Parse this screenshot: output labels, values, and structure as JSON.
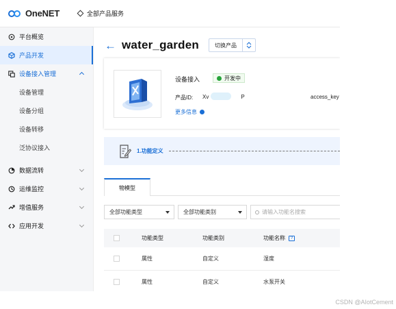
{
  "topbar": {
    "logo_text": "OneNET",
    "all_products": "全部产品服务"
  },
  "sidebar": {
    "items": [
      {
        "label": "平台概览",
        "icon": "circle-gear-icon",
        "state": "normal"
      },
      {
        "label": "产品开发",
        "icon": "cube-icon",
        "state": "active"
      },
      {
        "label": "设备接入管理",
        "icon": "device-icon",
        "state": "open"
      },
      {
        "label": "设备管理",
        "sub": true
      },
      {
        "label": "设备分组",
        "sub": true
      },
      {
        "label": "设备转移",
        "sub": true
      },
      {
        "label": "泛协议接入",
        "sub": true
      },
      {
        "label": "数据流转",
        "icon": "flow-icon",
        "state": "collapsed"
      },
      {
        "label": "运维监控",
        "icon": "monitor-icon",
        "state": "collapsed"
      },
      {
        "label": "增值服务",
        "icon": "plus-service-icon",
        "state": "collapsed"
      },
      {
        "label": "应用开发",
        "icon": "app-dev-icon",
        "state": "collapsed"
      }
    ]
  },
  "product": {
    "name": "water_garden",
    "switch_label": "切换产品",
    "card_title": "设备接入",
    "status": "开发中",
    "pid_label": "产品ID:",
    "pid_prefix": "Xv",
    "pid_suffix": "P",
    "access_key_label": "access_key",
    "more_info": "更多信息"
  },
  "steps": {
    "step1": "1.功能定义"
  },
  "tabs": {
    "model": "物模型"
  },
  "filters": {
    "type_select": "全部功能类型",
    "category_select": "全部功能类别",
    "search_placeholder": "请输入功能名搜索"
  },
  "table": {
    "headers": [
      "功能类型",
      "功能类别",
      "功能名称"
    ],
    "rows": [
      [
        "属性",
        "自定义",
        "湿度"
      ],
      [
        "属性",
        "自定义",
        "水泵开关"
      ]
    ]
  },
  "watermark": "CSDN @AIotCement",
  "colors": {
    "accent": "#1a6fd6",
    "status_green": "#27a33a",
    "sidebar_bg": "#f5f6f8"
  }
}
